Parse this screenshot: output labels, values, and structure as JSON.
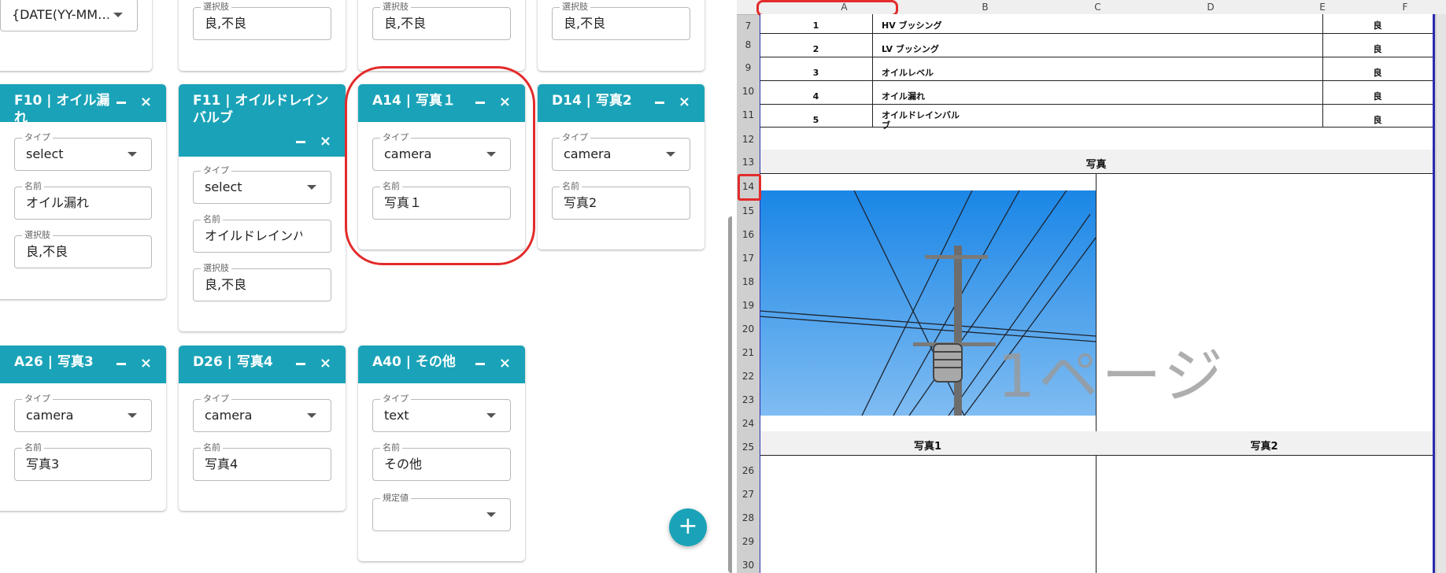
{
  "cards": [
    {
      "id": "c-date",
      "title": "",
      "fields": [
        {
          "label": "",
          "value": "{DATE(YY-MM…",
          "select": true
        }
      ]
    },
    {
      "id": "c-b-top",
      "title": "",
      "fields": [
        {
          "label": "選択肢",
          "value": "良,不良",
          "select": false
        }
      ]
    },
    {
      "id": "c-c-top",
      "title": "",
      "fields": [
        {
          "label": "選択肢",
          "value": "良,不良",
          "select": false
        }
      ]
    },
    {
      "id": "c-d-top",
      "title": "",
      "fields": [
        {
          "label": "選択肢",
          "value": "良,不良",
          "select": false
        }
      ]
    },
    {
      "id": "c-f10",
      "title": "F10 | オイル漏れ",
      "fields": [
        {
          "label": "タイプ",
          "value": "select",
          "select": true
        },
        {
          "label": "名前",
          "value": "オイル漏れ",
          "select": false
        },
        {
          "label": "選択肢",
          "value": "良,不良",
          "select": false
        }
      ]
    },
    {
      "id": "c-f11",
      "title": "F11 | オイルドレイン バルブ",
      "fields": [
        {
          "label": "タイプ",
          "value": "select",
          "select": true
        },
        {
          "label": "名前",
          "value": "オイルドレインバル",
          "select": false
        },
        {
          "label": "選択肢",
          "value": "良,不良",
          "select": false
        }
      ]
    },
    {
      "id": "c-a14",
      "title": "A14 | 写真１",
      "fields": [
        {
          "label": "タイプ",
          "value": "camera",
          "select": true
        },
        {
          "label": "名前",
          "value": "写真１",
          "select": false
        }
      ]
    },
    {
      "id": "c-d14",
      "title": "D14 | 写真2",
      "fields": [
        {
          "label": "タイプ",
          "value": "camera",
          "select": true
        },
        {
          "label": "名前",
          "value": "写真2",
          "select": false
        }
      ]
    },
    {
      "id": "c-a26",
      "title": "A26 | 写真3",
      "fields": [
        {
          "label": "タイプ",
          "value": "camera",
          "select": true
        },
        {
          "label": "名前",
          "value": "写真3",
          "select": false
        }
      ]
    },
    {
      "id": "c-d26",
      "title": "D26 | 写真4",
      "fields": [
        {
          "label": "タイプ",
          "value": "camera",
          "select": true
        },
        {
          "label": "名前",
          "value": "写真4",
          "select": false
        }
      ]
    },
    {
      "id": "c-a40",
      "title": "A40 | その他",
      "fields": [
        {
          "label": "タイプ",
          "value": "text",
          "select": true
        },
        {
          "label": "名前",
          "value": "その他",
          "select": false
        },
        {
          "label": "規定値",
          "value": "",
          "select": true
        }
      ]
    }
  ],
  "fab_label": "+",
  "sheet": {
    "columns": [
      "A",
      "B",
      "C",
      "D",
      "E",
      "F"
    ],
    "rows": [
      "7",
      "8",
      "9",
      "10",
      "11",
      "12",
      "13",
      "14",
      "15",
      "16",
      "17",
      "18",
      "19",
      "20",
      "21",
      "22",
      "23",
      "24",
      "25",
      "26",
      "27",
      "28",
      "29",
      "30"
    ],
    "items": [
      {
        "no": "1",
        "name": "HV ブッシング",
        "result": "良"
      },
      {
        "no": "2",
        "name": "LV ブッシング",
        "result": "良"
      },
      {
        "no": "3",
        "name": "オイルレベル",
        "result": "良"
      },
      {
        "no": "4",
        "name": "オイル漏れ",
        "result": "良"
      },
      {
        "no": "5",
        "name": "オイルドレインバル\nブ",
        "result": "良"
      }
    ],
    "photo_section_title": "写真",
    "photo1_label": "写真1",
    "photo2_label": "写真2",
    "page_watermark": "1ページ"
  },
  "colors": {
    "accent": "#1aa3b8",
    "highlight": "#e32b2b"
  }
}
